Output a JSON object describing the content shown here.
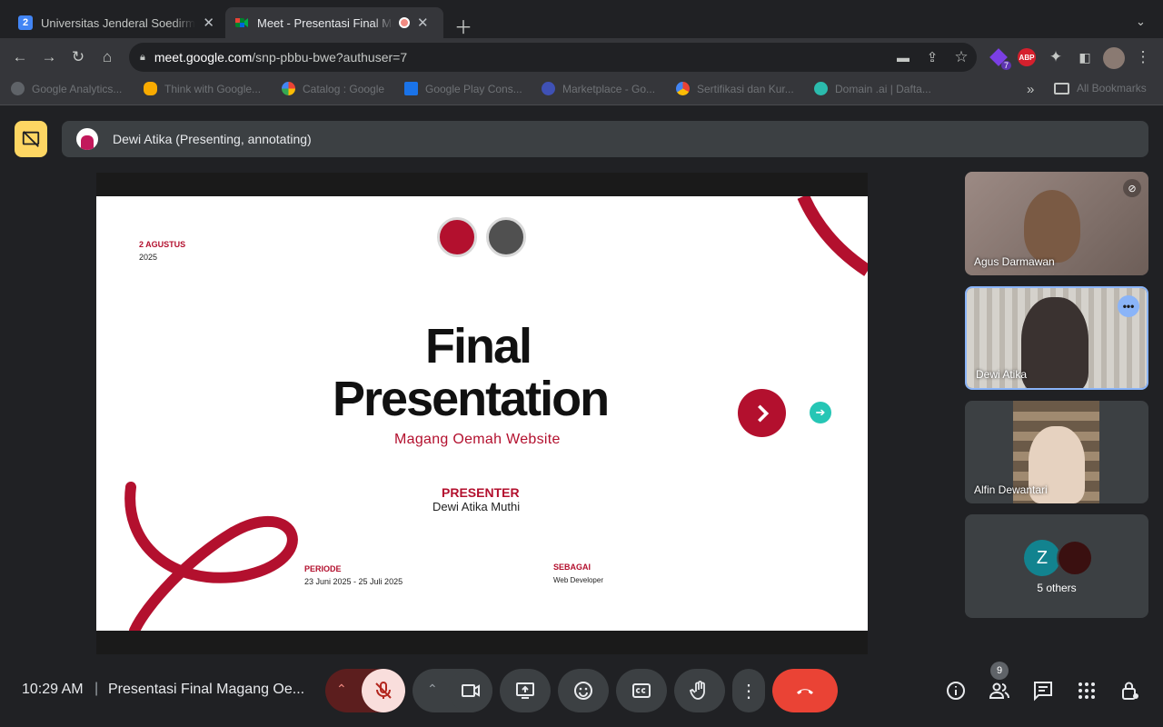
{
  "browser": {
    "tabs": [
      {
        "title": "Universitas Jenderal Soedirman",
        "favicon_text": "2",
        "active": false
      },
      {
        "title": "Meet - Presentasi Final Magang",
        "active": true
      }
    ],
    "url_domain": "meet.google.com",
    "url_path": "/snp-pbbu-bwe?authuser=7",
    "extension_badge": "7",
    "abp_label": "ABP",
    "bookmarks": [
      "Google Analytics...",
      "Think with Google...",
      "Catalog : Google",
      "Google Play Cons...",
      "Marketplace - Go...",
      "Sertifikasi dan Kur...",
      "Domain .ai | Dafta..."
    ],
    "bookmarks_overflow": "»",
    "all_bookmarks": "All Bookmarks"
  },
  "meet": {
    "banner_text": "Dewi Atika (Presenting, annotating)",
    "slide": {
      "date_line1": "2 AGUSTUS",
      "date_line2": "2025",
      "title_line1": "Final",
      "title_line2": "Presentation",
      "subtitle": "Magang Oemah Website",
      "presenter_label": "PRESENTER",
      "presenter_name": "Dewi Atika Muthi",
      "periode_label": "PERIODE",
      "periode_value": "23 Juni 2025 - 25 Juli 2025",
      "sebagai_label": "SEBAGAI",
      "sebagai_value": "Web Developer",
      "accent_color": "#b3102e"
    },
    "participants": [
      {
        "name": "Agus Darmawan"
      },
      {
        "name": "Dewi Atika"
      },
      {
        "name": "Alfin Dewantari"
      }
    ],
    "others_label": "5 others",
    "others_avatar_letter": "Z",
    "time": "10:29 AM",
    "separator": "|",
    "meeting_title": "Presentasi Final Magang Oe...",
    "people_count": "9"
  }
}
